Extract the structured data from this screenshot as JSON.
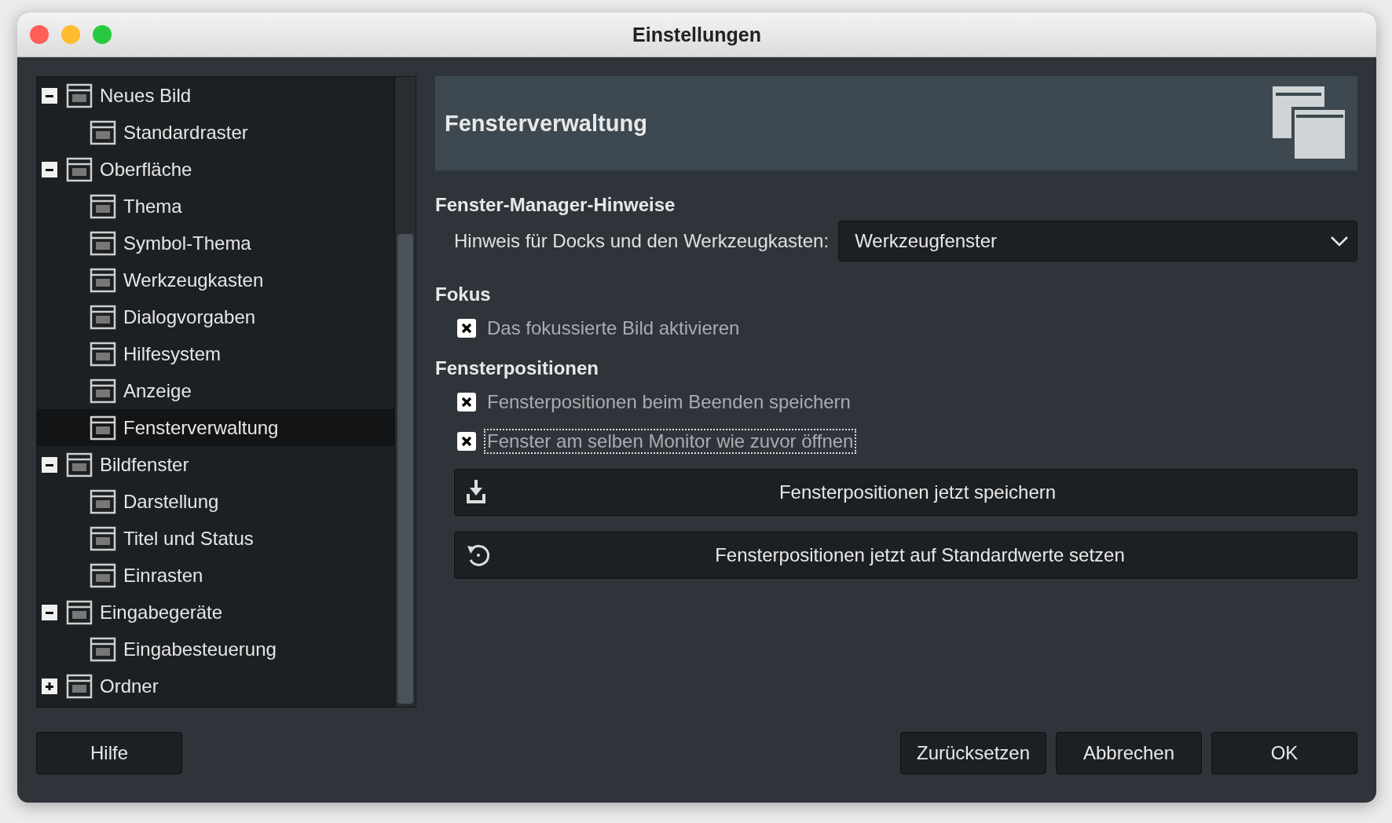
{
  "window": {
    "title": "Einstellungen"
  },
  "tree": [
    {
      "label": "Neues Bild",
      "expanded": true,
      "selected": false,
      "children": [
        {
          "label": "Standardraster",
          "selected": false
        }
      ]
    },
    {
      "label": "Oberfläche",
      "expanded": true,
      "selected": false,
      "children": [
        {
          "label": "Thema",
          "selected": false
        },
        {
          "label": "Symbol-Thema",
          "selected": false
        },
        {
          "label": "Werkzeugkasten",
          "selected": false
        },
        {
          "label": "Dialogvorgaben",
          "selected": false
        },
        {
          "label": "Hilfesystem",
          "selected": false
        },
        {
          "label": "Anzeige",
          "selected": false
        },
        {
          "label": "Fensterverwaltung",
          "selected": true
        }
      ]
    },
    {
      "label": "Bildfenster",
      "expanded": true,
      "selected": false,
      "children": [
        {
          "label": "Darstellung",
          "selected": false
        },
        {
          "label": "Titel und Status",
          "selected": false
        },
        {
          "label": "Einrasten",
          "selected": false
        }
      ]
    },
    {
      "label": "Eingabegeräte",
      "expanded": true,
      "selected": false,
      "children": [
        {
          "label": "Eingabesteuerung",
          "selected": false
        }
      ]
    },
    {
      "label": "Ordner",
      "expanded": false,
      "selected": false
    }
  ],
  "page": {
    "title": "Fensterverwaltung",
    "sections": [
      {
        "heading": "Fenster-Manager-Hinweise",
        "items": [
          {
            "kind": "dropdown",
            "label": "Hinweis für Docks und den Werkzeugkasten:",
            "value": "Werkzeugfenster"
          }
        ]
      },
      {
        "heading": "Fokus",
        "items": [
          {
            "kind": "checkbox",
            "label": "Das fokussierte Bild aktivieren",
            "checked": true,
            "focused": false
          }
        ]
      },
      {
        "heading": "Fensterpositionen",
        "items": [
          {
            "kind": "checkbox",
            "label": "Fensterpositionen beim Beenden speichern",
            "checked": true,
            "focused": false
          },
          {
            "kind": "checkbox",
            "label": "Fenster am selben Monitor wie zuvor öffnen",
            "checked": true,
            "focused": true
          },
          {
            "kind": "button",
            "label": "Fensterpositionen jetzt speichern"
          },
          {
            "kind": "button",
            "label": "Fensterpositionen jetzt auf Standardwerte setzen"
          }
        ]
      }
    ]
  },
  "buttons_left": [
    "Hilfe"
  ],
  "buttons_right": [
    "Zurücksetzen",
    "Abbrechen",
    "OK"
  ]
}
